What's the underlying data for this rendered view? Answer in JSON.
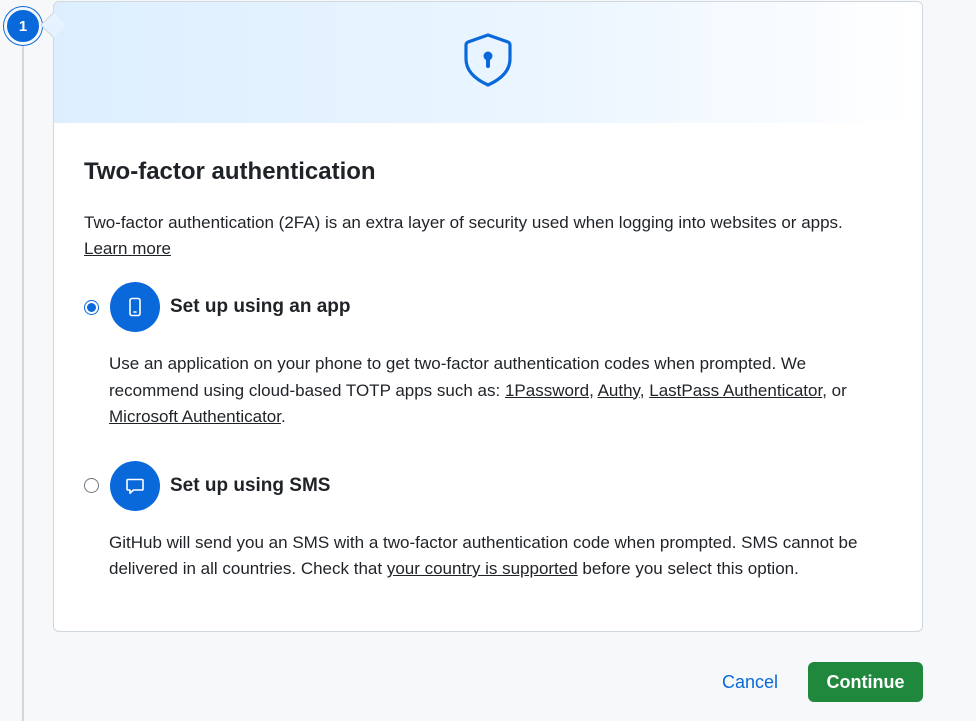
{
  "step": {
    "number": "1"
  },
  "hero": {
    "icon": "shield-lock-icon"
  },
  "content": {
    "title": "Two-factor authentication",
    "description": "Two-factor authentication (2FA) is an extra layer of security used when logging into websites or apps.",
    "learn_more": "Learn more"
  },
  "options": {
    "app": {
      "label": "Set up using an app",
      "icon": "device-mobile-icon",
      "selected": true,
      "desc_1": "Use an application on your phone to get two-factor authentication codes when prompted. We recommend using cloud-based TOTP apps such as: ",
      "apps": [
        "1Password",
        "Authy",
        "LastPass Authenticator",
        "Microsoft Authenticator"
      ],
      "sep_1": ", ",
      "sep_2": ", ",
      "sep_3": ", or ",
      "end": "."
    },
    "sms": {
      "label": "Set up using SMS",
      "icon": "comment-icon",
      "selected": false,
      "desc_1": "GitHub will send you an SMS with a two-factor authentication code when prompted. SMS cannot be delivered in all countries. Check that ",
      "link": "your country is supported",
      "desc_2": " before you select this option."
    }
  },
  "actions": {
    "cancel": "Cancel",
    "continue": "Continue"
  },
  "colors": {
    "accent": "#0969da",
    "primary_button": "#1f883d"
  }
}
